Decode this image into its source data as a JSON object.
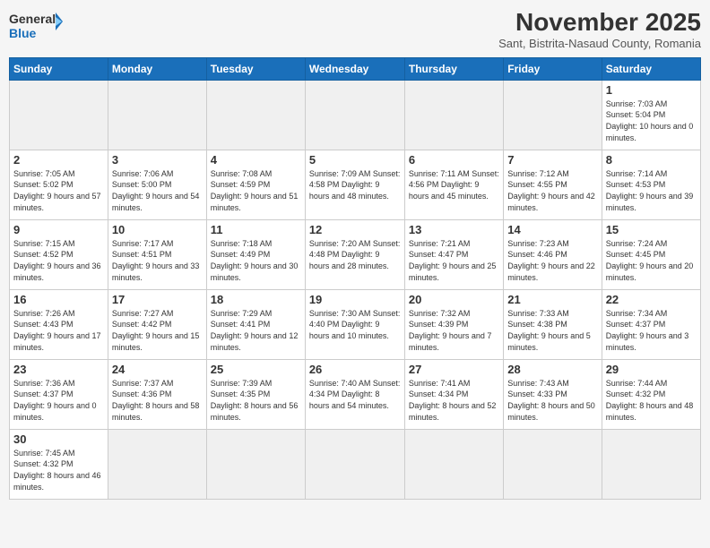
{
  "logo": {
    "general": "General",
    "blue": "Blue"
  },
  "header": {
    "month": "November 2025",
    "location": "Sant, Bistrita-Nasaud County, Romania"
  },
  "weekdays": [
    "Sunday",
    "Monday",
    "Tuesday",
    "Wednesday",
    "Thursday",
    "Friday",
    "Saturday"
  ],
  "weeks": [
    [
      {
        "day": "",
        "info": ""
      },
      {
        "day": "",
        "info": ""
      },
      {
        "day": "",
        "info": ""
      },
      {
        "day": "",
        "info": ""
      },
      {
        "day": "",
        "info": ""
      },
      {
        "day": "",
        "info": ""
      },
      {
        "day": "1",
        "info": "Sunrise: 7:03 AM\nSunset: 5:04 PM\nDaylight: 10 hours\nand 0 minutes."
      }
    ],
    [
      {
        "day": "2",
        "info": "Sunrise: 7:05 AM\nSunset: 5:02 PM\nDaylight: 9 hours\nand 57 minutes."
      },
      {
        "day": "3",
        "info": "Sunrise: 7:06 AM\nSunset: 5:00 PM\nDaylight: 9 hours\nand 54 minutes."
      },
      {
        "day": "4",
        "info": "Sunrise: 7:08 AM\nSunset: 4:59 PM\nDaylight: 9 hours\nand 51 minutes."
      },
      {
        "day": "5",
        "info": "Sunrise: 7:09 AM\nSunset: 4:58 PM\nDaylight: 9 hours\nand 48 minutes."
      },
      {
        "day": "6",
        "info": "Sunrise: 7:11 AM\nSunset: 4:56 PM\nDaylight: 9 hours\nand 45 minutes."
      },
      {
        "day": "7",
        "info": "Sunrise: 7:12 AM\nSunset: 4:55 PM\nDaylight: 9 hours\nand 42 minutes."
      },
      {
        "day": "8",
        "info": "Sunrise: 7:14 AM\nSunset: 4:53 PM\nDaylight: 9 hours\nand 39 minutes."
      }
    ],
    [
      {
        "day": "9",
        "info": "Sunrise: 7:15 AM\nSunset: 4:52 PM\nDaylight: 9 hours\nand 36 minutes."
      },
      {
        "day": "10",
        "info": "Sunrise: 7:17 AM\nSunset: 4:51 PM\nDaylight: 9 hours\nand 33 minutes."
      },
      {
        "day": "11",
        "info": "Sunrise: 7:18 AM\nSunset: 4:49 PM\nDaylight: 9 hours\nand 30 minutes."
      },
      {
        "day": "12",
        "info": "Sunrise: 7:20 AM\nSunset: 4:48 PM\nDaylight: 9 hours\nand 28 minutes."
      },
      {
        "day": "13",
        "info": "Sunrise: 7:21 AM\nSunset: 4:47 PM\nDaylight: 9 hours\nand 25 minutes."
      },
      {
        "day": "14",
        "info": "Sunrise: 7:23 AM\nSunset: 4:46 PM\nDaylight: 9 hours\nand 22 minutes."
      },
      {
        "day": "15",
        "info": "Sunrise: 7:24 AM\nSunset: 4:45 PM\nDaylight: 9 hours\nand 20 minutes."
      }
    ],
    [
      {
        "day": "16",
        "info": "Sunrise: 7:26 AM\nSunset: 4:43 PM\nDaylight: 9 hours\nand 17 minutes."
      },
      {
        "day": "17",
        "info": "Sunrise: 7:27 AM\nSunset: 4:42 PM\nDaylight: 9 hours\nand 15 minutes."
      },
      {
        "day": "18",
        "info": "Sunrise: 7:29 AM\nSunset: 4:41 PM\nDaylight: 9 hours\nand 12 minutes."
      },
      {
        "day": "19",
        "info": "Sunrise: 7:30 AM\nSunset: 4:40 PM\nDaylight: 9 hours\nand 10 minutes."
      },
      {
        "day": "20",
        "info": "Sunrise: 7:32 AM\nSunset: 4:39 PM\nDaylight: 9 hours\nand 7 minutes."
      },
      {
        "day": "21",
        "info": "Sunrise: 7:33 AM\nSunset: 4:38 PM\nDaylight: 9 hours\nand 5 minutes."
      },
      {
        "day": "22",
        "info": "Sunrise: 7:34 AM\nSunset: 4:37 PM\nDaylight: 9 hours\nand 3 minutes."
      }
    ],
    [
      {
        "day": "23",
        "info": "Sunrise: 7:36 AM\nSunset: 4:37 PM\nDaylight: 9 hours\nand 0 minutes."
      },
      {
        "day": "24",
        "info": "Sunrise: 7:37 AM\nSunset: 4:36 PM\nDaylight: 8 hours\nand 58 minutes."
      },
      {
        "day": "25",
        "info": "Sunrise: 7:39 AM\nSunset: 4:35 PM\nDaylight: 8 hours\nand 56 minutes."
      },
      {
        "day": "26",
        "info": "Sunrise: 7:40 AM\nSunset: 4:34 PM\nDaylight: 8 hours\nand 54 minutes."
      },
      {
        "day": "27",
        "info": "Sunrise: 7:41 AM\nSunset: 4:34 PM\nDaylight: 8 hours\nand 52 minutes."
      },
      {
        "day": "28",
        "info": "Sunrise: 7:43 AM\nSunset: 4:33 PM\nDaylight: 8 hours\nand 50 minutes."
      },
      {
        "day": "29",
        "info": "Sunrise: 7:44 AM\nSunset: 4:32 PM\nDaylight: 8 hours\nand 48 minutes."
      }
    ],
    [
      {
        "day": "30",
        "info": "Sunrise: 7:45 AM\nSunset: 4:32 PM\nDaylight: 8 hours\nand 46 minutes."
      },
      {
        "day": "",
        "info": ""
      },
      {
        "day": "",
        "info": ""
      },
      {
        "day": "",
        "info": ""
      },
      {
        "day": "",
        "info": ""
      },
      {
        "day": "",
        "info": ""
      },
      {
        "day": "",
        "info": ""
      }
    ]
  ]
}
